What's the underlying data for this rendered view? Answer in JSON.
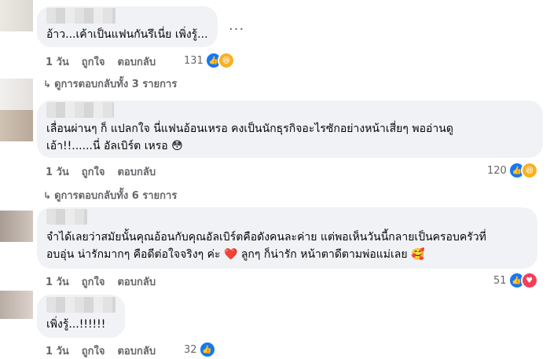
{
  "comments": [
    {
      "text_lines": [
        "อ้าว...เค้าเป็นแฟนกันรึเนี่ย เพิ่งรู้..."
      ],
      "time": "1 วัน",
      "like_label": "ถูกใจ",
      "reply_label": "ตอบกลับ",
      "reaction_count": "131",
      "reactions": [
        "like-icon",
        "haha-icon"
      ],
      "view_replies": "ดูการตอบกลับทั้ง 3 รายการ"
    },
    {
      "text_lines": [
        "เลื่อนผ่านๆ ก็ แปลกใจ นี่แฟนอ้อนเหรอ คงเป็นนักธุรกิจอะไรซักอย่างหน้าเสี่ยๆ พออ่านดู",
        "เอ้า!!......นี่ อัลเบิร์ต เหรอ 😳"
      ],
      "time": "1 วัน",
      "like_label": "ถูกใจ",
      "reply_label": "ตอบกลับ",
      "reaction_count": "120",
      "reactions": [
        "like-icon",
        "haha-icon"
      ],
      "view_replies": "ดูการตอบกลับทั้ง 6 รายการ"
    },
    {
      "text_lines": [
        "จำได้เลยว่าสมัยนั้นคุณอ้อนกับคุณอัลเบิร์ตคือดังคนละค่าย แต่พอเห็นวันนี้กลายเป็นครอบครัวที่",
        "อบอุ่น น่ารักมากๆ คือดีต่อใจจริงๆ ค่ะ ❤️ ลูกๆ ก็น่ารัก หน้าตาดีตามพ่อแม่เลย 🥰"
      ],
      "time": "1 วัน",
      "like_label": "ถูกใจ",
      "reply_label": "ตอบกลับ",
      "reaction_count": "51",
      "reactions": [
        "like-icon",
        "love-icon"
      ]
    },
    {
      "text_lines": [
        "เพิ่งรู้...!!!!!!"
      ],
      "time": "1 วัน",
      "like_label": "ถูกใจ",
      "reply_label": "ตอบกลับ",
      "reaction_count": "32",
      "reactions": [
        "like-icon"
      ]
    }
  ],
  "more_label": "...",
  "colors": {
    "like": "#1877f2",
    "haha": "#f7b125",
    "love": "#f33e58",
    "bubble": "#f0f2f5",
    "meta": "#65676b"
  }
}
